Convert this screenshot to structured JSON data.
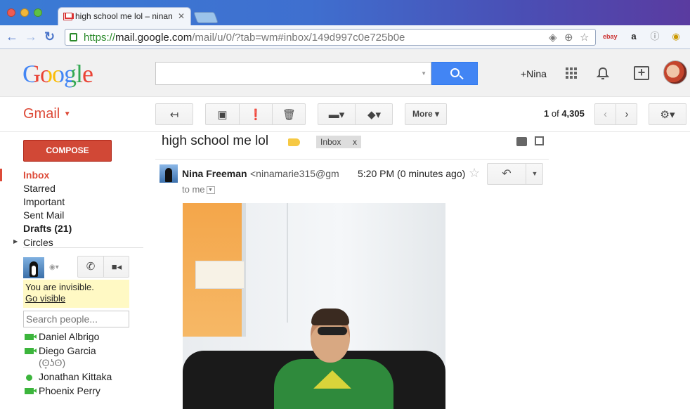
{
  "browser": {
    "tab_title": "high school me lol – ninan",
    "url_scheme": "https://",
    "url_host": "mail.google.com",
    "url_path": "/mail/u/0/?tab=wm#inbox/149d997c0e725b0e"
  },
  "header": {
    "logo": "Google",
    "search_placeholder": "",
    "user_link": "+Nina"
  },
  "subbar": {
    "app_label": "Gmail",
    "more_label": "More",
    "page_current": "1",
    "page_of": "of",
    "page_total": "4,305"
  },
  "sidebar": {
    "compose": "COMPOSE",
    "items": [
      {
        "label": "Inbox"
      },
      {
        "label": "Starred"
      },
      {
        "label": "Important"
      },
      {
        "label": "Sent Mail"
      },
      {
        "label": "Drafts (21)"
      },
      {
        "label": "Circles"
      }
    ]
  },
  "chat": {
    "invisible_text": "You are invisible.",
    "go_visible": "Go visible",
    "search_placeholder": "Search people...",
    "contacts": [
      {
        "name": "Daniel Albrigo",
        "status": "video"
      },
      {
        "name": "Diego Garcia",
        "status": "video",
        "extra": "(ʘ̥ʖʘ)"
      },
      {
        "name": "Jonathan Kittaka",
        "status": "online"
      },
      {
        "name": "Phoenix Perry",
        "status": "video"
      }
    ]
  },
  "message": {
    "subject": "high school me lol",
    "label": "Inbox",
    "label_close": "x",
    "sender_name": "Nina Freeman",
    "sender_email": "<ninamarie315@gm",
    "time": "5:20 PM (0 minutes ago)",
    "to": "to me"
  },
  "colors": {
    "accent_red": "#dd4b39",
    "compose_red": "#d14836",
    "search_blue": "#4285f4",
    "label_yellow": "#f6c944",
    "online_green": "#3cb53c"
  }
}
